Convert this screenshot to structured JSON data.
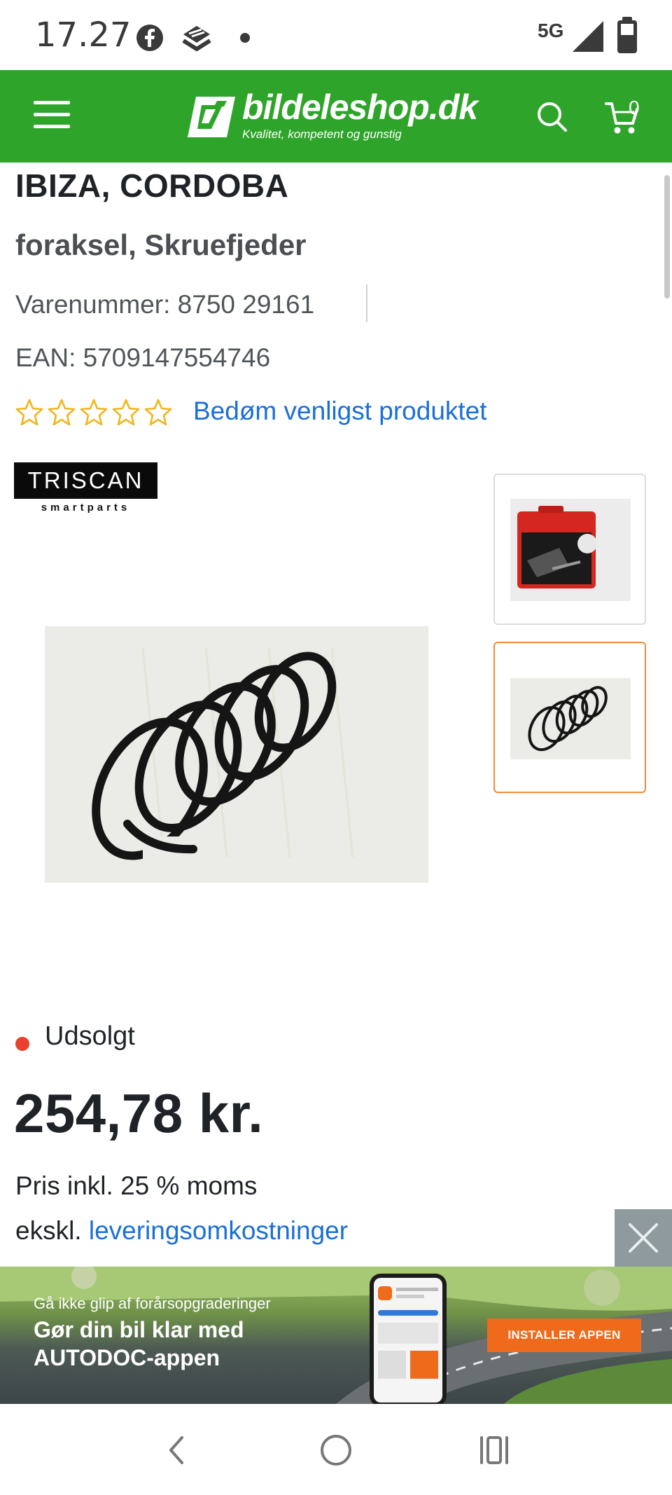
{
  "status_bar": {
    "time": "17.27",
    "network": "5G",
    "icons": [
      "facebook-icon",
      "layers-app-icon",
      "notification-dot-icon",
      "signal-icon",
      "battery-icon"
    ]
  },
  "header": {
    "brand": "bildeleshop.dk",
    "tagline": "Kvalitet, kompetent og gunstig",
    "cart_count": "0",
    "bg_color": "#2ea52a"
  },
  "product": {
    "title": "IBIZA, CORDOBA",
    "subtitle": "foraksel, Skruefjeder",
    "item_number": "Varenummer: 8750 29161",
    "ean": "EAN: 5709147554746",
    "rating_stars": 0,
    "rating_max": 5,
    "rate_link": "Bedøm venligst produktet",
    "brand_name": "TRISCAN",
    "brand_sub": "smartparts",
    "stock_status": "Udsolgt",
    "price": "254,78 kr.",
    "price_note": "Pris inkl. 25 % moms",
    "delivery_prefix": "ekskl.",
    "delivery_link": "leveringsomkostninger",
    "selected_thumbnail": 2
  },
  "ad": {
    "line1": "Gå ikke glip af forårsopgraderinger",
    "line2": "Gør din bil klar med",
    "line3": "AUTODOC-appen",
    "button": "INSTALLER APPEN",
    "button_color": "#f06a1c"
  },
  "colors": {
    "accent_link": "#1a6fd6",
    "star_color": "#f2b51d",
    "out_of_stock": "#e9402f",
    "selected_border": "#f08a3c"
  }
}
